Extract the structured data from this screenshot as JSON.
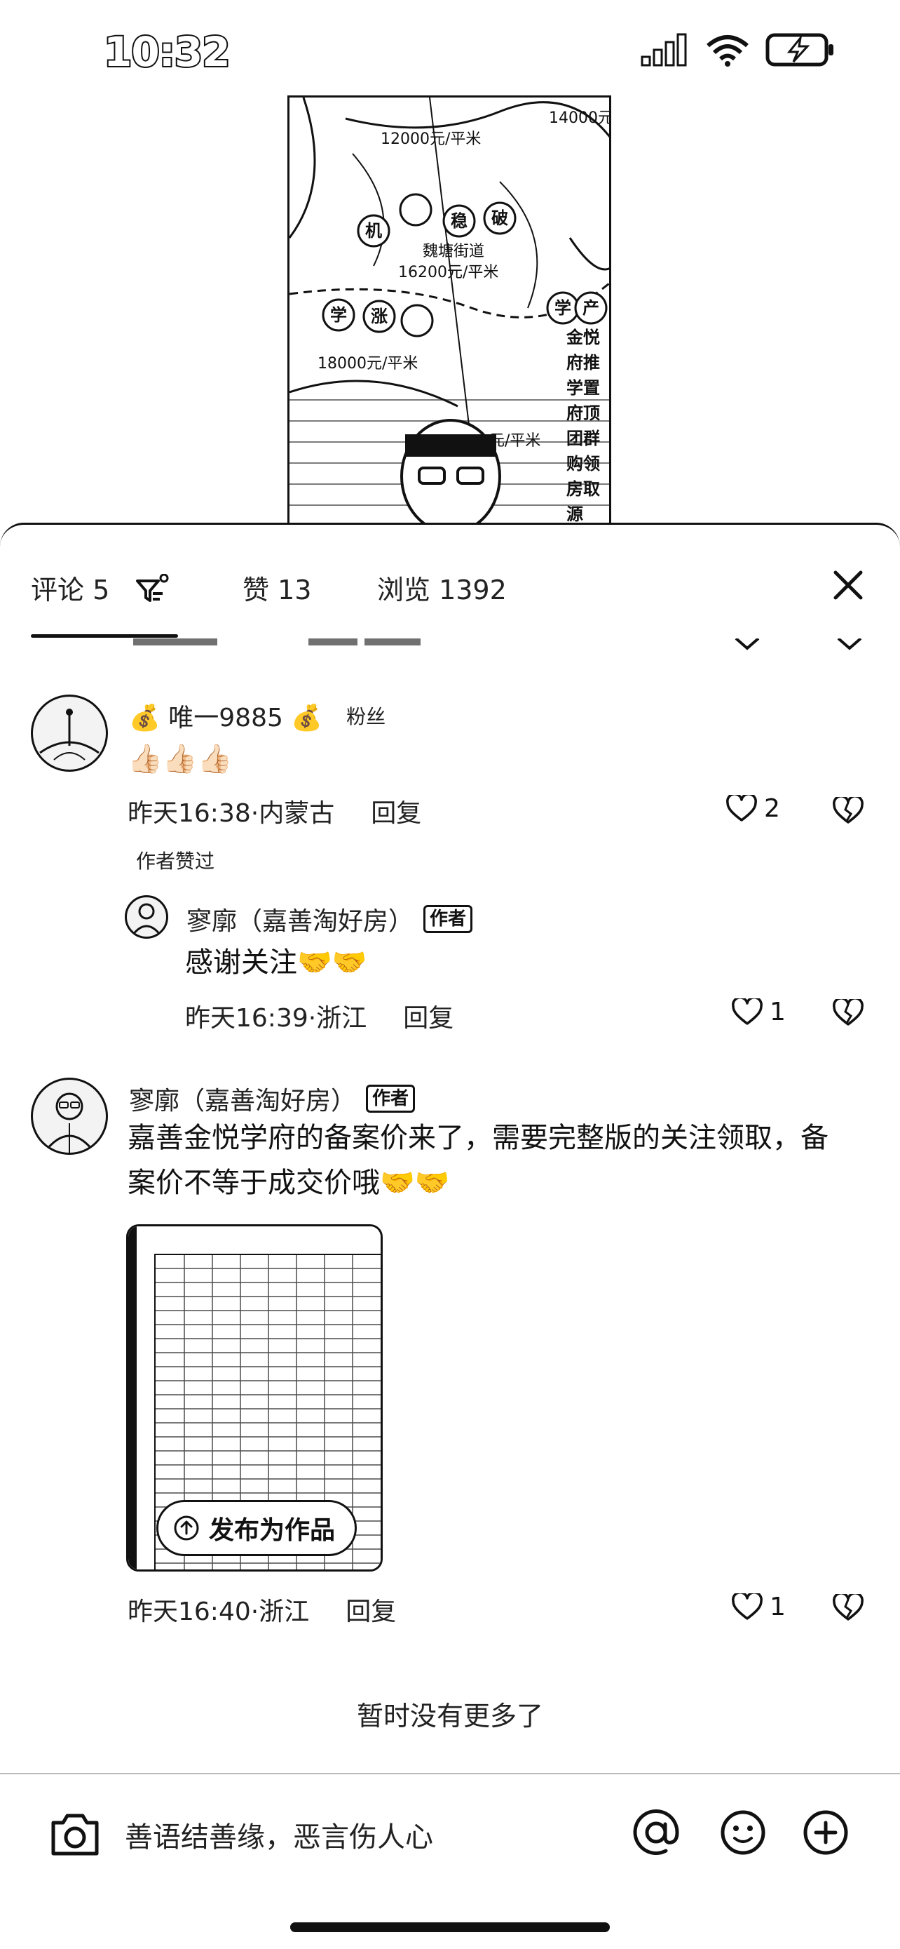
{
  "status_bar": {
    "time": "10:32"
  },
  "video": {
    "map_texts": [
      "14000元",
      "12000元/平米",
      "16200元/平米",
      "18000元/平米",
      "魏塘街道",
      "元/平米"
    ],
    "tags": [
      "机",
      "稳",
      "破",
      "学",
      "涨",
      "学",
      "产"
    ],
    "side_text": [
      "金悦",
      "府",
      "推",
      "学",
      "置",
      "府",
      "顶",
      "团",
      "群",
      "购",
      "领",
      "房",
      "取",
      "源"
    ]
  },
  "tabs": {
    "comments_label": "评论 5",
    "likes_label": "赞 13",
    "views_label": "浏览 1392"
  },
  "comments": [
    {
      "name": "💰 唯一9885 💰",
      "badge": "粉丝",
      "text": "👍🏻👍🏻👍🏻",
      "time": "昨天16:38·内蒙古",
      "reply_label": "回复",
      "likes": "2",
      "author_liked": "作者赞过"
    },
    {
      "name": "寥廓（嘉善淘好房）",
      "badge": "作者",
      "text": "感谢关注🤝🤝",
      "time": "昨天16:39·浙江",
      "reply_label": "回复",
      "likes": "1"
    },
    {
      "name": "寥廓（嘉善淘好房）",
      "badge": "作者",
      "text": "嘉善金悦学府的备案价来了，需要完整版的关注领取，备案价不等于成交价哦🤝🤝",
      "time": "昨天16:40·浙江",
      "reply_label": "回复",
      "likes": "1",
      "image_action": "发布为作品"
    }
  ],
  "footer": {
    "no_more": "暂时没有更多了",
    "input_placeholder": "善语结善缘，恶言伤人心"
  }
}
